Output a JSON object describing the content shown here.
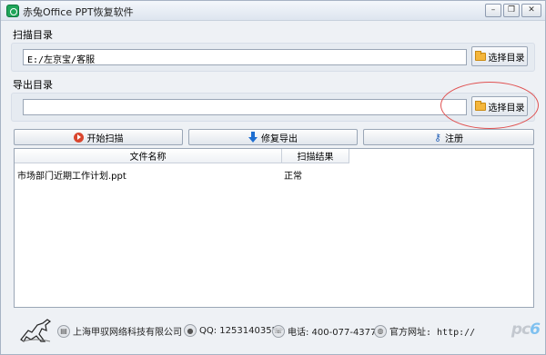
{
  "window": {
    "title": "赤兔Office PPT恢复软件",
    "controls": {
      "minimize": "–",
      "restore": "❐",
      "close": "✕"
    }
  },
  "scan_section": {
    "label": "扫描目录",
    "path_value": "E:/左京宝/客服",
    "button_label": "选择目录"
  },
  "export_section": {
    "label": "导出目录",
    "path_value": "",
    "button_label": "选择目录"
  },
  "actions": {
    "start_scan": "开始扫描",
    "repair_export": "修复导出",
    "register": "注册"
  },
  "table": {
    "columns": [
      "文件名称",
      "扫描结果"
    ],
    "rows": [
      {
        "file_name": "市场部门近期工作计划.ppt",
        "result": "正常"
      }
    ]
  },
  "footer": {
    "company": "上海甲驭网络科技有限公司",
    "qq": "QQ: 1253140355",
    "phone": "电话: 400-077-4377",
    "website": "官方网址: http://",
    "watermark": {
      "main": "pc",
      "accent": "6"
    }
  },
  "colors": {
    "highlight_circle": "#e05252",
    "play_icon": "#d9462e",
    "down_icon": "#1f6fd1",
    "folder_icon": "#f4b63c"
  }
}
